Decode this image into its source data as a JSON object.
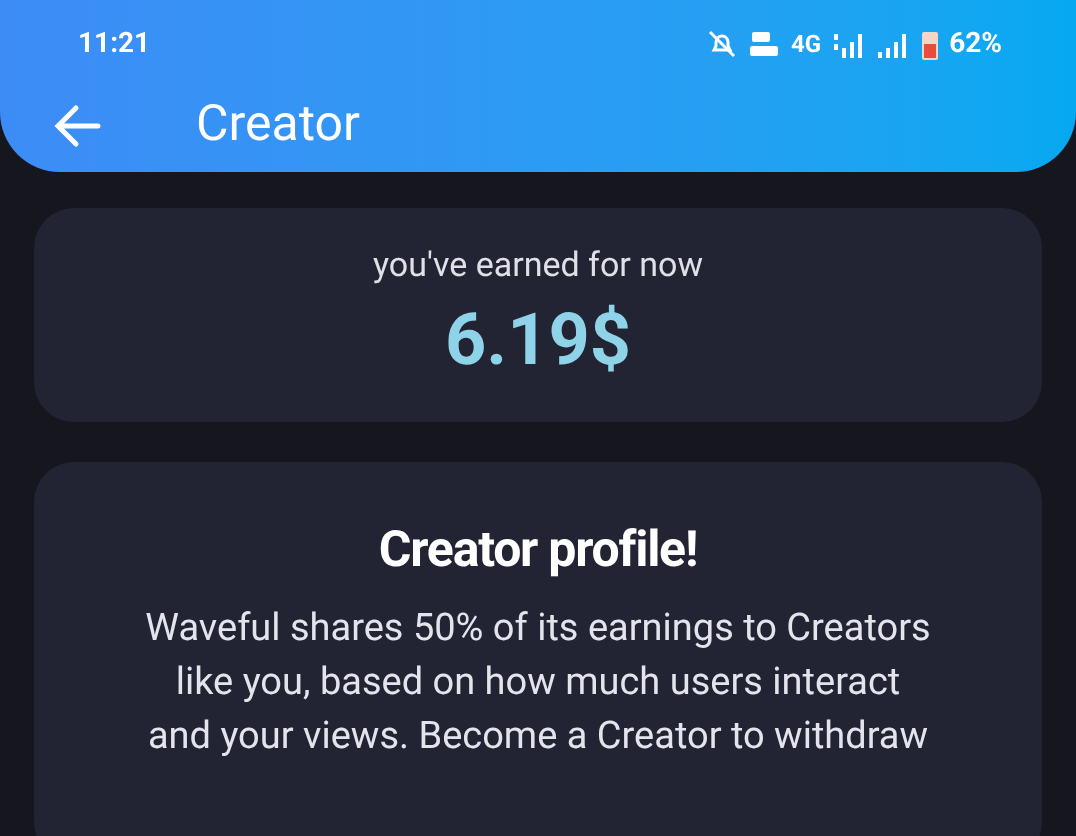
{
  "status_bar": {
    "time": "11:21",
    "network": "4G",
    "battery": "62%"
  },
  "app_bar": {
    "title": "Creator"
  },
  "earnings_card": {
    "label": "you've earned for now",
    "amount": "6.19$"
  },
  "creator_card": {
    "title": "Creator profile!",
    "description_lines": [
      "Waveful shares 50% of its earnings to Creators",
      "like you, based on how much users interact",
      "and your views. Become a Creator to withdraw"
    ]
  }
}
